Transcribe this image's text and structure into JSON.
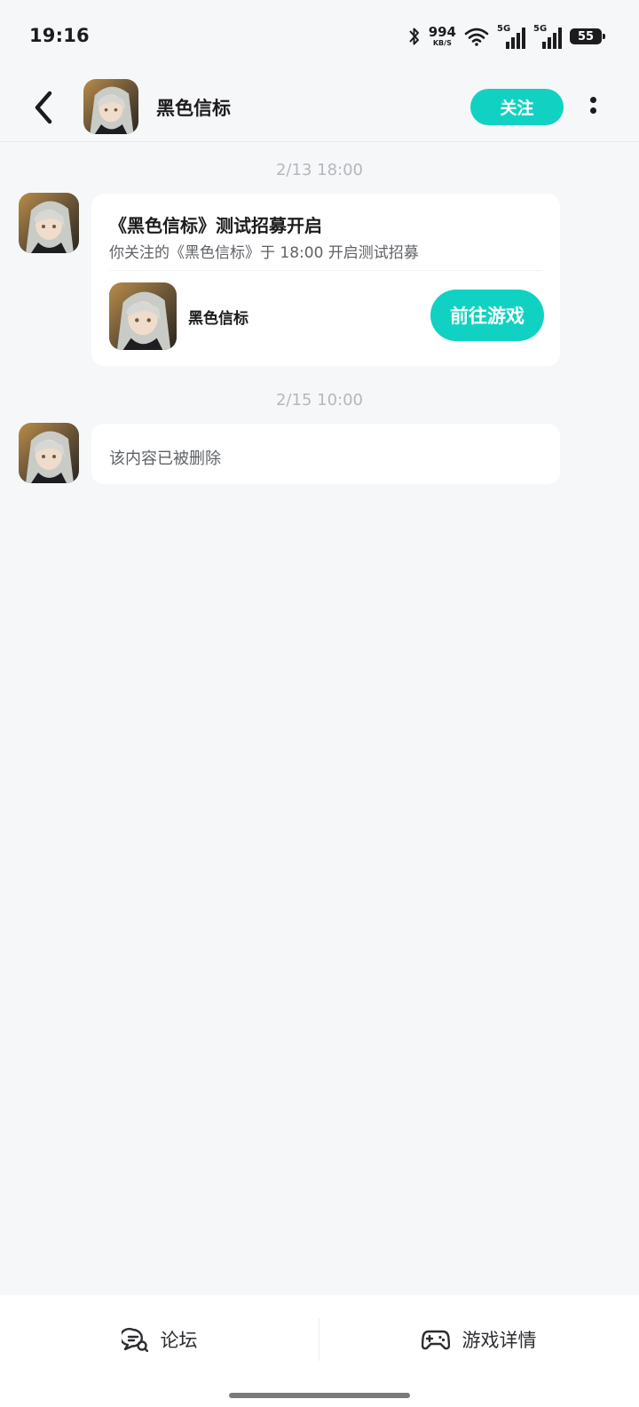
{
  "status_bar": {
    "time": "19:16",
    "net_speed": "994",
    "net_unit": "KB/S",
    "sim1_label": "5G",
    "sim2_label": "5G",
    "battery": "55",
    "icons": [
      "bluetooth-icon",
      "wifi-icon",
      "signal-icon",
      "signal-icon",
      "battery-icon"
    ]
  },
  "header": {
    "title": "黑色信标",
    "follow_label": "关注",
    "icons": [
      "back-arrow-icon",
      "more-vertical-icon"
    ]
  },
  "messages": [
    {
      "time": "2/13  18:00",
      "title": "《黑色信标》测试招募开启",
      "desc": "你关注的《黑色信标》于 18:00 开启测试招募",
      "game_name": "黑色信标",
      "button_label": "前往游戏"
    },
    {
      "time": "2/15  10:00",
      "text": "该内容已被删除"
    }
  ],
  "bottom_bar": {
    "tabs": [
      {
        "label": "论坛",
        "icon": "forum-chat-icon"
      },
      {
        "label": "游戏详情",
        "icon": "gamepad-icon"
      }
    ]
  },
  "colors": {
    "accent": "#11d2c2",
    "background": "#f6f7f9",
    "card": "#ffffff"
  }
}
